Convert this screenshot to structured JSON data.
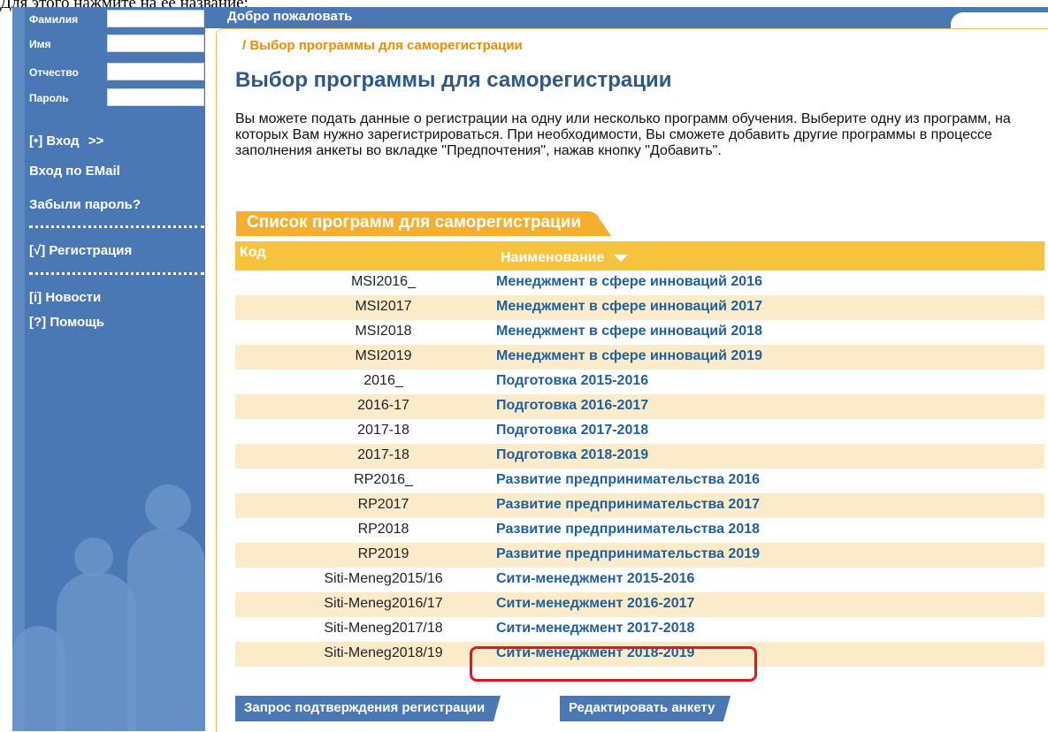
{
  "doc_caption": "Для этого нажмите на ее название:",
  "sidebar": {
    "fields": [
      {
        "label": "Фамилия"
      },
      {
        "label": "Имя"
      },
      {
        "label": "Отчество"
      },
      {
        "label": "Пароль"
      }
    ],
    "login": {
      "icon_text": "[•]",
      "label": "Вход",
      "arrow": ">>"
    },
    "email_login": "Вход по EMail",
    "forgot": "Забыли пароль?",
    "register": {
      "icon_text": "[√]",
      "label": "Регистрация"
    },
    "news": {
      "icon_text": "[i]",
      "label": "Новости"
    },
    "help": {
      "icon_text": "[?]",
      "label": "Помощь"
    }
  },
  "header": {
    "title": "Добро пожаловать"
  },
  "breadcrumb": "/ Выбор программы для саморегистрации",
  "page_title": "Выбор программы для саморегистрации",
  "intro": "Вы можете подать данные о регистрации на одну или несколько программ обучения. Выберите одну из программ, на которых Вам нужно зарегистрироваться. При необходимости, Вы сможете добавить другие программы в процессе заполнения анкеты во вкладке \"Предпочтения\", нажав кнопку \"Добавить\".",
  "list": {
    "title": "Список программ для саморегистрации",
    "headers": {
      "code": "Код",
      "name": "Наименование"
    },
    "rows": [
      {
        "code": "MSI2016_",
        "name": "Менеджмент в сфере инноваций 2016"
      },
      {
        "code": "MSI2017",
        "name": "Менеджмент в сфере инноваций 2017"
      },
      {
        "code": "MSI2018",
        "name": "Менеджмент в сфере инноваций 2018"
      },
      {
        "code": "MSI2019",
        "name": "Менеджмент в сфере инноваций 2019"
      },
      {
        "code": "2016_",
        "name": "Подготовка 2015-2016"
      },
      {
        "code": "2016-17",
        "name": "Подготовка 2016-2017"
      },
      {
        "code": "2017-18",
        "name": "Подготовка 2017-2018"
      },
      {
        "code": "2017-18",
        "name": "Подготовка 2018-2019"
      },
      {
        "code": "RP2016_",
        "name": "Развитие предпринимательства 2016"
      },
      {
        "code": "RP2017",
        "name": "Развитие предпринимательства 2017"
      },
      {
        "code": "RP2018",
        "name": "Развитие предпринимательства 2018"
      },
      {
        "code": "RP2019",
        "name": "Развитие предпринимательства 2019"
      },
      {
        "code": "Siti-Meneg2015/16",
        "name": "Сити-менеджмент 2015-2016"
      },
      {
        "code": "Siti-Meneg2016/17",
        "name": "Сити-менеджмент 2016-2017"
      },
      {
        "code": "Siti-Meneg2017/18",
        "name": "Сити-менеджмент 2017-2018"
      },
      {
        "code": "Siti-Meneg2018/19",
        "name": "Сити-менеджмент 2018-2019"
      }
    ]
  },
  "buttons": {
    "confirm": "Запрос подтверждения регистрации",
    "edit": "Редактировать анкету"
  }
}
